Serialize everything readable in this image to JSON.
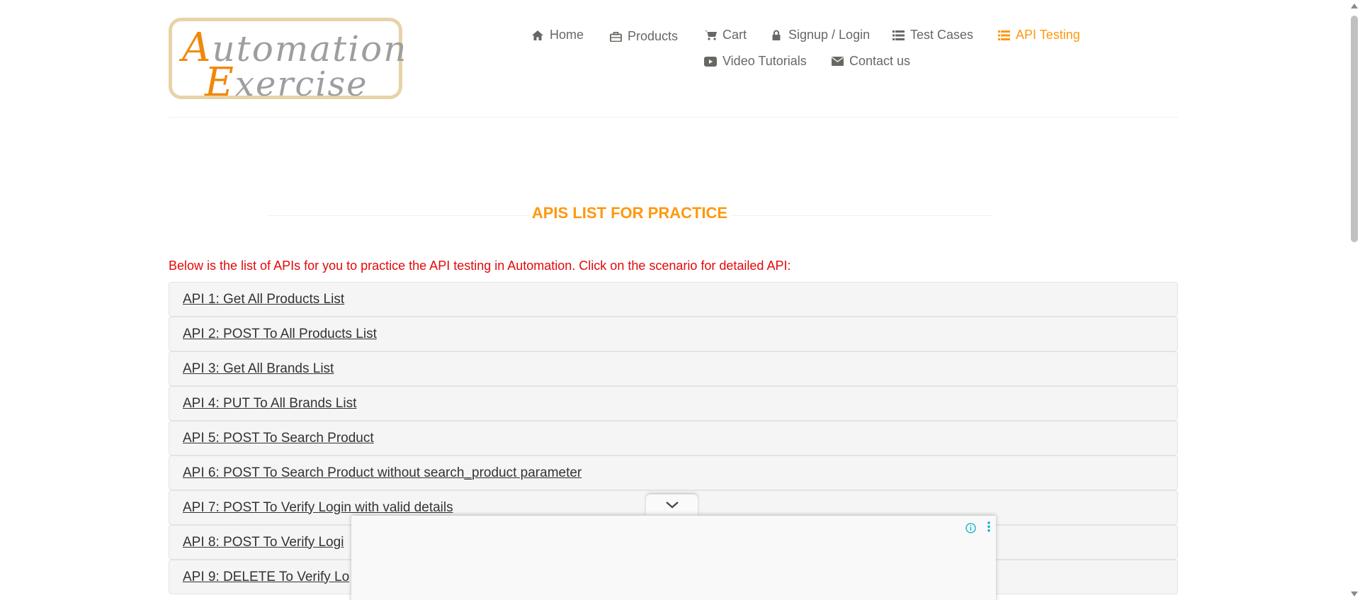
{
  "logo": {
    "line1_cap": "A",
    "line1_rest": "utomation",
    "line2_cap": "E",
    "line2_rest": "xercise"
  },
  "nav": {
    "items": [
      {
        "label": "Home",
        "icon": "home-icon"
      },
      {
        "label": "Products",
        "icon": "briefcase-icon"
      },
      {
        "label": "Cart",
        "icon": "shopping-cart-icon"
      },
      {
        "label": "Signup / Login",
        "icon": "lock-icon"
      },
      {
        "label": "Test Cases",
        "icon": "list-icon"
      },
      {
        "label": "API Testing",
        "icon": "list-icon",
        "active": true
      },
      {
        "label": "Video Tutorials",
        "icon": "youtube-play-icon"
      },
      {
        "label": "Contact us",
        "icon": "envelope-icon"
      }
    ]
  },
  "main": {
    "title": "APIS LIST FOR PRACTICE",
    "intro": "Below is the list of APIs for you to practice the API testing in Automation. Click on the scenario for detailed API:",
    "apis": [
      "API 1: Get All Products List",
      "API 2: POST To All Products List",
      "API 3: Get All Brands List",
      "API 4: PUT To All Brands List",
      "API 5: POST To Search Product",
      "API 6: POST To Search Product without search_product parameter",
      "API 7: POST To Verify Login with valid details",
      "API 8: POST To Verify Logi",
      "API 9: DELETE To Verify Lo"
    ]
  },
  "ad": {
    "info_icon": "info-icon",
    "menu_icon": "more-vertical-icon"
  },
  "colors": {
    "accent": "#fe980f",
    "intro": "#e4080a",
    "row_bg": "#f5f5f5"
  }
}
